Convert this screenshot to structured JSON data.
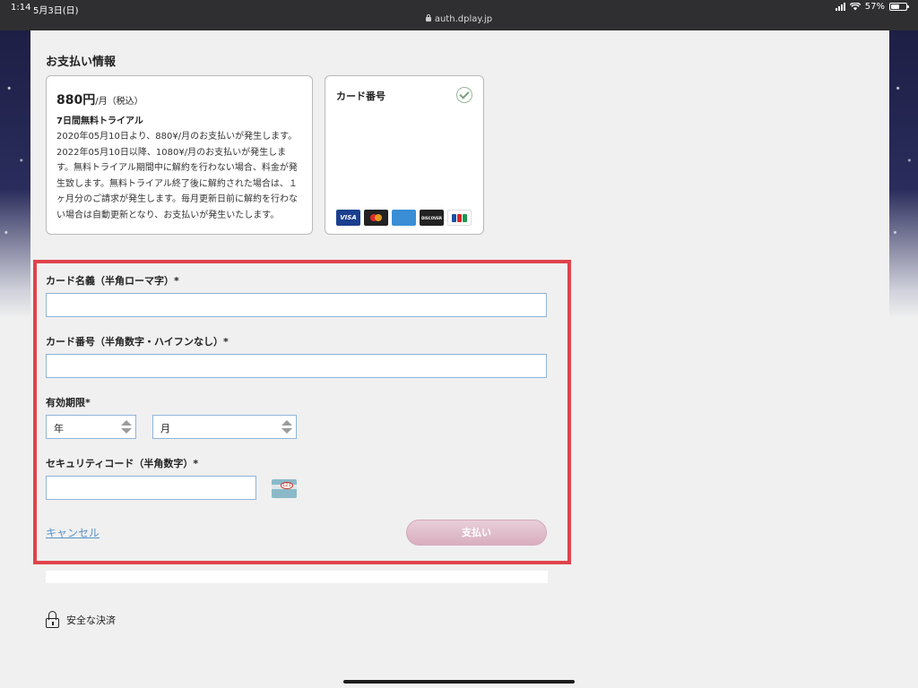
{
  "status_bar": {
    "time": "1:14",
    "date": "5月3日(日)",
    "url": "auth.dplay.jp",
    "battery": "57%",
    "battery_level": 0.57
  },
  "section_title": "お支払い情報",
  "plan": {
    "price": "880円",
    "unit": "/月（税込）",
    "trial": "7日間無料トライアル",
    "description": "2020年05月10日より、880¥/月のお支払いが発生します。2022年05月10日以降、1080¥/月のお支払いが発生します。無料トライアル期間中に解約を行わない場合、料金が発生致します。無料トライアル終了後に解約された場合は、１ヶ月分のご請求が発生します。毎月更新日前に解約を行わない場合は自動更新となり、お支払いが発生いたします。"
  },
  "card_box": {
    "label": "カード番号",
    "brands": [
      "VISA",
      "mastercard",
      "AMERICAN EXPRESS",
      "DISCOVER",
      "JCB"
    ]
  },
  "form": {
    "name_label": "カード名義（半角ローマ字）*",
    "number_label": "カード番号（半角数字・ハイフンなし）*",
    "expiry_label": "有効期限*",
    "year_value": "年",
    "month_value": "月",
    "security_label": "セキュリティコード（半角数字）*",
    "cvv_hint": "123",
    "cancel_label": "キャンセル",
    "pay_label": "支払い"
  },
  "secure_label": "安全な決済",
  "colors": {
    "highlight_border": "#e0434b",
    "pay_button": "#d9aebf",
    "link": "#5a93c9",
    "input_border": "#8fb4d9"
  }
}
